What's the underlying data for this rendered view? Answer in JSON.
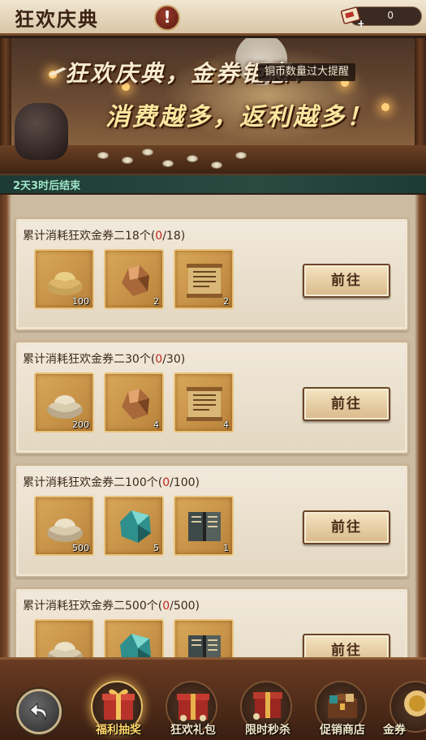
{
  "header": {
    "title": "狂欢庆典",
    "help_symbol": "!",
    "currency_value": "0",
    "currency_icon": "ticket-icon"
  },
  "banner": {
    "slogan_line1": "狂欢庆典，金券钜惠！",
    "slogan_line2": "消费越多，返利越多！",
    "notice": "铜币数量过大提醒",
    "timer": "2天3时后结束"
  },
  "tasks": [
    {
      "text_prefix": "累计消耗狂欢金券二18个(",
      "progress_current": "0",
      "progress_suffix": "/18)",
      "rewards": [
        {
          "icon": "gold-ingot-icon",
          "count": "100"
        },
        {
          "icon": "copper-ore-icon",
          "count": "2"
        },
        {
          "icon": "scroll-icon",
          "count": "2"
        }
      ],
      "button": "前往"
    },
    {
      "text_prefix": "累计消耗狂欢金券二30个(",
      "progress_current": "0",
      "progress_suffix": "/30)",
      "rewards": [
        {
          "icon": "silver-ingot-icon",
          "count": "200"
        },
        {
          "icon": "copper-ore-icon",
          "count": "4"
        },
        {
          "icon": "scroll-icon",
          "count": "4"
        }
      ],
      "button": "前往"
    },
    {
      "text_prefix": "累计消耗狂欢金券二100个(",
      "progress_current": "0",
      "progress_suffix": "/100)",
      "rewards": [
        {
          "icon": "silver-ingot-icon",
          "count": "500"
        },
        {
          "icon": "jade-gem-icon",
          "count": "5"
        },
        {
          "icon": "book-icon",
          "count": "1"
        }
      ],
      "button": "前往"
    },
    {
      "text_prefix": "累计消耗狂欢金券二500个(",
      "progress_current": "0",
      "progress_suffix": "/500)",
      "rewards": [
        {
          "icon": "silver-ingot-icon",
          "count": ""
        },
        {
          "icon": "jade-gem-icon",
          "count": ""
        },
        {
          "icon": "book-icon",
          "count": ""
        }
      ],
      "button": "前往"
    }
  ],
  "nav": {
    "back_icon": "back-arrow-icon",
    "items": [
      {
        "label": "福利抽奖",
        "active": true
      },
      {
        "label": "狂欢礼包",
        "active": false
      },
      {
        "label": "限时秒杀",
        "active": false
      },
      {
        "label": "促销商店",
        "active": false
      },
      {
        "label": "金券",
        "active": false
      }
    ]
  },
  "colors": {
    "progress_red": "#c0281e",
    "active_label": "#ffd66b",
    "timer_text": "#9fe6c9"
  }
}
